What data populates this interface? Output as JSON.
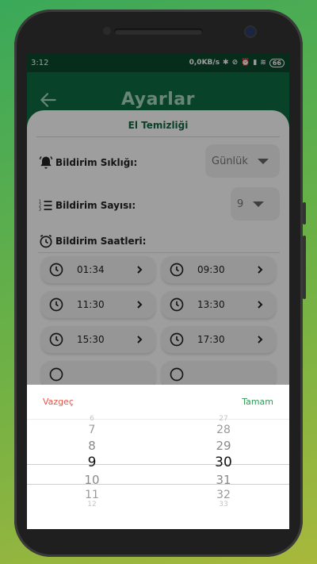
{
  "status": {
    "time": "3:12",
    "net_speed": "0,0KB/s",
    "battery": "66"
  },
  "header": {
    "title": "Ayarlar"
  },
  "card": {
    "title": "El Temizliği"
  },
  "settings": {
    "frequency_label": "Bildirim Sıklığı:",
    "frequency_value": "Günlük",
    "count_label": "Bildirim Sayısı:",
    "count_value": "9",
    "times_label": "Bildirim Saatleri:"
  },
  "times": [
    "01:34",
    "09:30",
    "11:30",
    "13:30",
    "15:30",
    "17:30"
  ],
  "picker": {
    "cancel": "Vazgeç",
    "done": "Tamam",
    "hours": [
      "6",
      "7",
      "8",
      "9",
      "10",
      "11",
      "12"
    ],
    "minutes": [
      "27",
      "28",
      "29",
      "30",
      "31",
      "32",
      "33"
    ],
    "selected_hour": "9",
    "selected_minute": "30"
  },
  "colors": {
    "primary": "#0d6b43",
    "accent_light": "#a9d8bd",
    "cancel": "#e3574b",
    "done": "#2f9a57"
  }
}
